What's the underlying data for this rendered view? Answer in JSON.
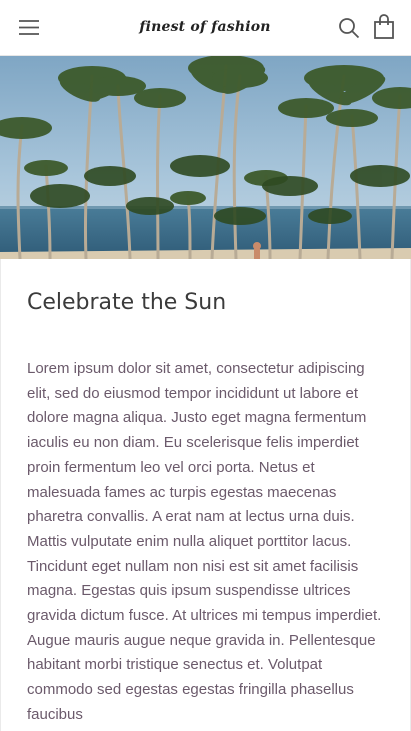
{
  "header": {
    "logo_text": "finest of fashion",
    "menu_icon": "hamburger-menu-icon",
    "search_icon": "search-icon",
    "cart_icon": "shopping-bag-icon"
  },
  "hero": {
    "image_subject": "palm-trees-beach-photo"
  },
  "article": {
    "title": "Celebrate the Sun",
    "body": "Lorem ipsum dolor sit amet, consectetur adipiscing elit, sed do eiusmod tempor incididunt ut labore et dolore magna aliqua. Justo eget magna fermentum iaculis eu non diam. Eu scelerisque felis imperdiet proin fermentum leo vel orci porta. Netus et malesuada fames ac turpis egestas maecenas pharetra convallis. A erat nam at lectus urna duis. Mattis vulputate enim nulla aliquet porttitor lacus. Tincidunt eget nullam non nisi est sit amet facilisis magna. Egestas quis ipsum suspendisse ultrices gravida dictum fusce. At ultrices mi tempus imperdiet. Augue mauris augue neque gravida in. Pellentesque habitant morbi tristique senectus et. Volutpat commodo sed egestas egestas fringilla phasellus faucibus"
  },
  "colors": {
    "title": "#3b3b3b",
    "body": "#6b5a6b",
    "sky": "#9bbcd4",
    "sea": "#3e6f8c",
    "palm": "#3d5a2c"
  }
}
